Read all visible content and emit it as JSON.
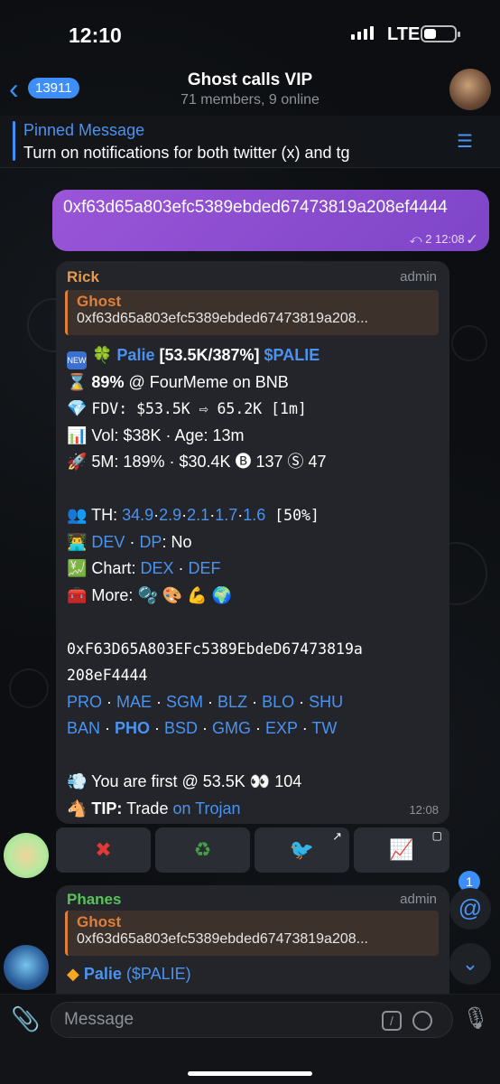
{
  "status": {
    "time": "12:10",
    "network": "LTE"
  },
  "header": {
    "back_count": "13911",
    "title": "Ghost calls VIP",
    "subtitle": "71 members, 9 online"
  },
  "pinned": {
    "title": "Pinned Message",
    "text": "Turn on notifications for both twitter (x) and tg"
  },
  "outgoing": {
    "text": "0xf63d65a803efc5389ebded67473819a208ef4444",
    "meta": "⤺ 2  12:08 ✓"
  },
  "msg1": {
    "sender": "Rick",
    "role": "admin",
    "reply_name": "Ghost",
    "reply_text": "0xf63d65a803efc5389ebded67473819a208...",
    "l1_name": "Palie",
    "l1_stat": " [53.5K/387%] ",
    "l1_ticker": "$PALIE",
    "l2_pct": "89%",
    "l2_rest": " @ FourMeme on BNB",
    "l3": "FDV: $53.5K ⇨ 65.2K [1m]",
    "l4": "Vol: $38K · Age: 13m",
    "l5": "5M: 189% · $30.4K 🅑 137 Ⓢ 47",
    "th_label": "TH: ",
    "th": [
      "34.9",
      "2.9",
      "2.1",
      "1.7",
      "1.6"
    ],
    "th_tail": " [50%]",
    "dev": "DEV",
    "dp": "DP",
    "dp_val": ": No",
    "chart_label": "Chart: ",
    "dex": "DEX",
    "def": "DEF",
    "more_label": "More: ",
    "addr1": "0xF63D65A803EFc5389EbdeD67473819a",
    "addr2": "208eF4444",
    "links1": [
      "PRO",
      "MAE",
      "SGM",
      "BLZ",
      "BLO",
      "SHU"
    ],
    "links2": [
      "BAN",
      "PHO",
      "BSD",
      "GMG",
      "EXP",
      "TW"
    ],
    "first": "You are first @ 53.5K 👀 104",
    "tip_label": "TIP:",
    "tip_text": " Trade ",
    "tip_link": "on Trojan",
    "time": "12:08"
  },
  "msg2": {
    "sender": "Phanes",
    "role": "admin",
    "reply_name": "Ghost",
    "reply_text": "0xf63d65a803efc5389ebded67473819a208...",
    "name": "Palie",
    "ticker": "($PALIE)"
  },
  "mention_count": "1",
  "input": {
    "placeholder": "Message"
  }
}
